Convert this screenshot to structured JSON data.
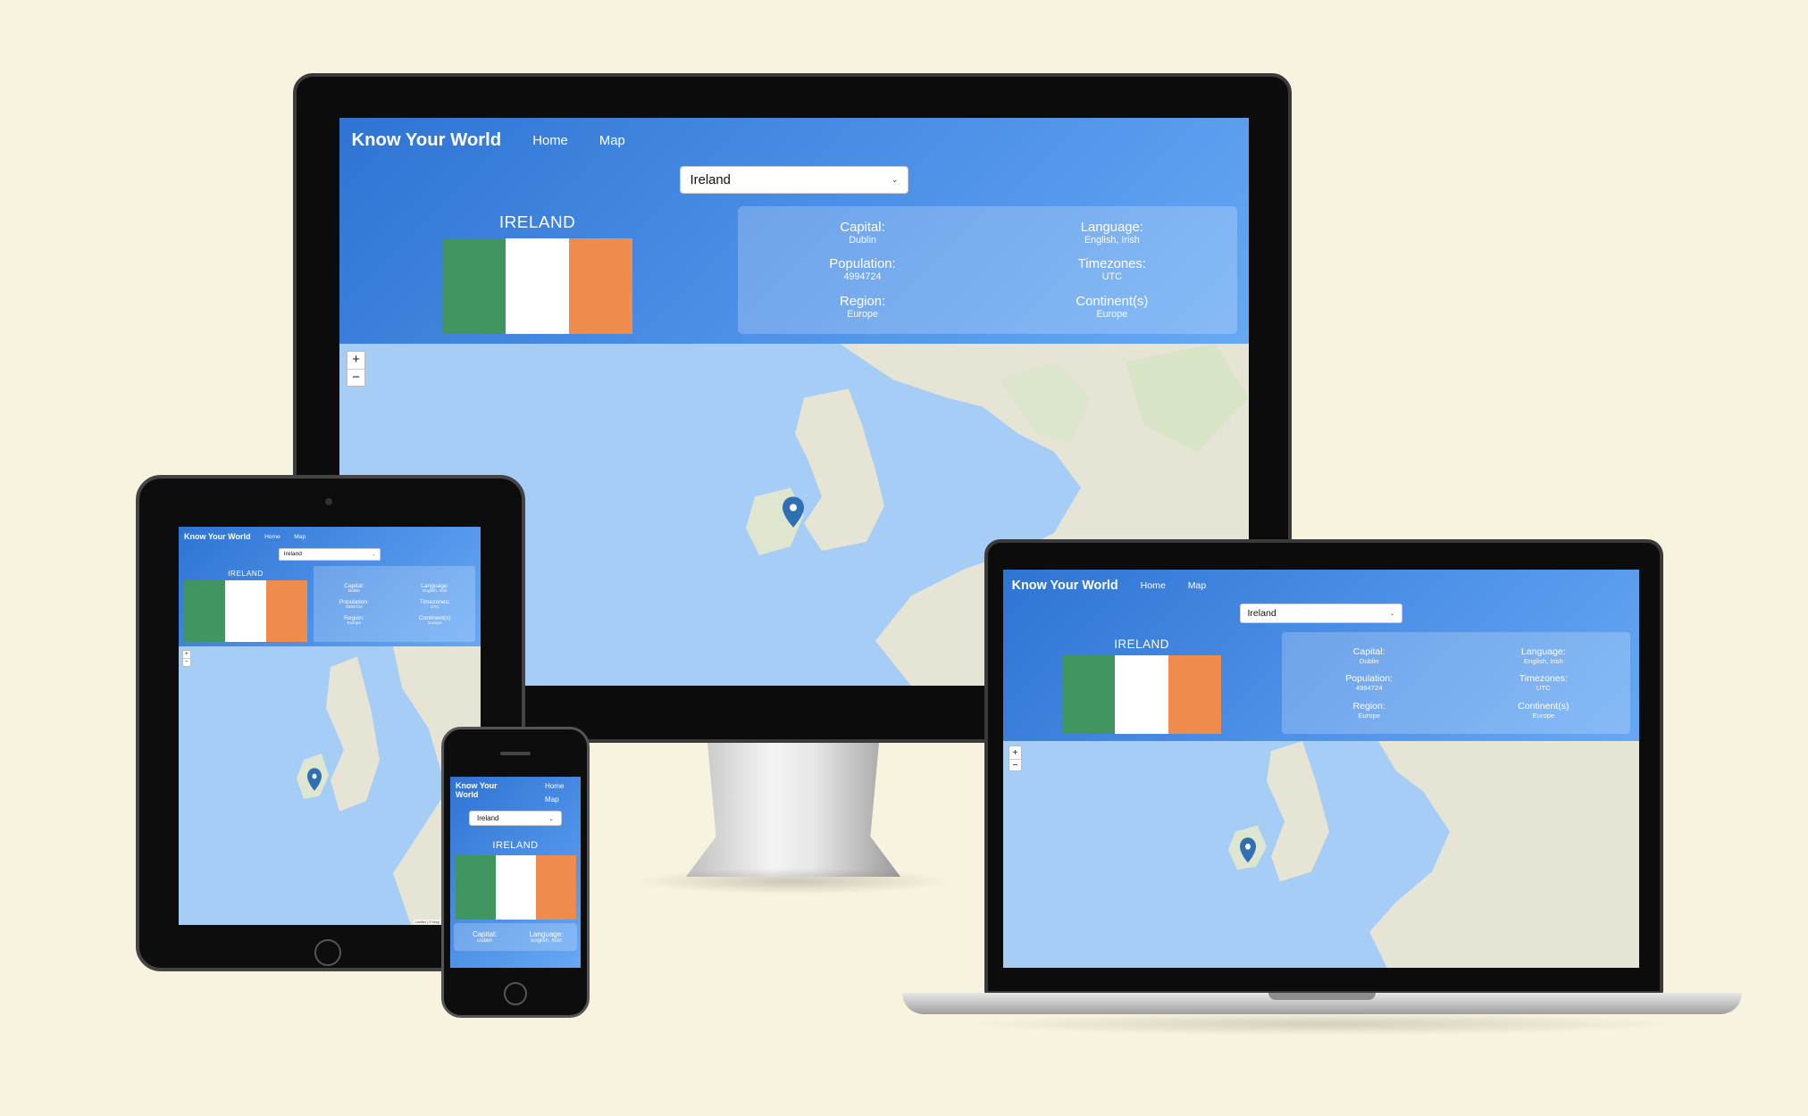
{
  "colors": {
    "background": "#f8f3df",
    "gradient_start": "#2f74d3",
    "gradient_end": "#66a8f4",
    "flag": [
      "#41955f",
      "#ffffff",
      "#ef8b4c"
    ],
    "sea": "#a6cdf5",
    "land": "#e8e6d8"
  },
  "app": {
    "brand": "Know Your World",
    "nav": {
      "home": "Home",
      "map": "Map"
    },
    "select": {
      "value": "Ireland"
    },
    "country": {
      "name": "IRELAND"
    },
    "facts": {
      "capital": {
        "label": "Capital:",
        "value": "Dublin"
      },
      "language": {
        "label": "Language:",
        "value": "English, Irish"
      },
      "population": {
        "label": "Population:",
        "value": "4994724"
      },
      "timezones": {
        "label": "Timezones:",
        "value": "UTC"
      },
      "region": {
        "label": "Region:",
        "value": "Europe"
      },
      "continents": {
        "label": "Continent(s)",
        "value": "Europe"
      }
    },
    "map": {
      "zoom_in": "+",
      "zoom_out": "−",
      "attribution": "Leaflet | © Map Tiler © OpenStreetMap"
    }
  }
}
